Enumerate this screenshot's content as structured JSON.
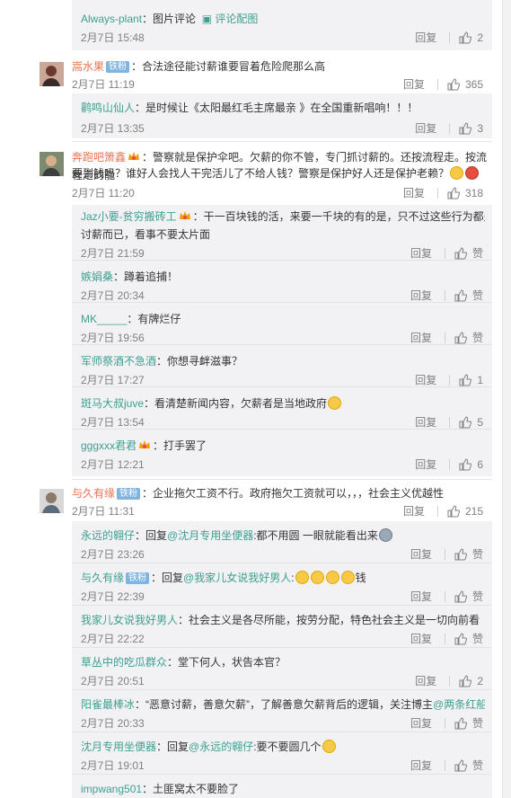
{
  "comments": [
    {
      "id": "c0-tail",
      "sub": [
        {
          "user": "Always-plant",
          "text": "：图片评论",
          "extra": "评论配图",
          "time": "2月7日 15:48",
          "reply": "回复",
          "likes": "2"
        }
      ]
    },
    {
      "id": "c1",
      "user": "嵩水果",
      "badge": "铁粉",
      "text": "：合法途径能讨薪谁要冒着危险爬那么高",
      "time": "2月7日 11:19",
      "reply": "回复",
      "likes": "365",
      "sub": [
        {
          "user": "鹳鸣山仙人",
          "text": "：是时候让《太阳最红毛主席最亲 》在全国重新唱响！！！",
          "time": "2月7日 13:35",
          "reply": "回复",
          "likes": "3"
        }
      ]
    },
    {
      "id": "c2",
      "user": "奔跑吧箫鑫",
      "text1": "：警察就是保护伞吧。欠薪的你不管，专门抓讨薪的。还按流程走。按流程走的能",
      "text2": "要到钱吗？谁好人会找人干完活儿了不给人钱？警察是保护好人还是保护老赖？",
      "time": "2月7日 11:20",
      "reply": "回复",
      "likes": "318",
      "sub": [
        {
          "user": "Jaz小要-贫穷搬砖工",
          "text1": "：干一百块钱的活，来要一千块的有的是，只不过这些行为都是恶意",
          "text2": "讨薪而已，看事不要太片面",
          "time": "2月7日 21:59",
          "reply": "回复",
          "likes": "赞"
        },
        {
          "user": "嫉娟桑",
          "text": "：蹲着追捕！",
          "time": "2月7日 20:34",
          "reply": "回复",
          "likes": "赞"
        },
        {
          "user": "MK_____",
          "text": "：有牌烂仔",
          "time": "2月7日 19:56",
          "reply": "回复",
          "likes": "赞"
        },
        {
          "user": "军师祭酒不急酒",
          "text": "：你想寻衅滋事？",
          "time": "2月7日 17:27",
          "reply": "回复",
          "likes": "1"
        },
        {
          "user": "斑马大叔juve",
          "text": "：看清楚新闻内容，欠薪者是当地政府",
          "time": "2月7日 13:54",
          "reply": "回复",
          "likes": "5"
        },
        {
          "user": "gggxxx君君",
          "text": "：打手罢了",
          "time": "2月7日 12:21",
          "reply": "回复",
          "likes": "6"
        }
      ]
    },
    {
      "id": "c3",
      "user": "与久有缘",
      "badge": "铁粉",
      "text": "：企业拖欠工资不行。政府拖欠工资就可以，，，社会主义优越性",
      "time": "2月7日 11:31",
      "reply": "回复",
      "likes": "215",
      "sub": [
        {
          "user": "永远的翱仔",
          "text": "：回复",
          "mention": "@沈月专用坐便器",
          "text2": ":都不用圆 一眼就能看出来",
          "time": "2月7日 23:26",
          "reply": "回复",
          "likes": "赞"
        },
        {
          "user": "与久有缘",
          "badge": "铁粉",
          "text": "：回复",
          "mention": "@我家儿女说我好男人",
          "text2": ":",
          "text3": "钱",
          "time": "2月7日 22:39",
          "reply": "回复",
          "likes": "赞"
        },
        {
          "user": "我家儿女说我好男人",
          "text": "：社会主义是各尽所能，按劳分配，特色社会主义是一切向前看",
          "time": "2月7日 22:22",
          "reply": "回复",
          "likes": "赞"
        },
        {
          "user": "草丛中的吃瓜群众",
          "text": "：堂下何人，状告本官？",
          "time": "2月7日 20:51",
          "reply": "回复",
          "likes": "2"
        },
        {
          "user": "阳雀最棒冰",
          "text": "：“恶意讨薪，善意欠薪”，了解善意欠薪背后的逻辑，关注博主",
          "mention": "@两条红船",
          "time": "2月7日 20:33",
          "reply": "回复",
          "likes": "赞"
        },
        {
          "user": "沈月专用坐便器",
          "text": "：回复",
          "mention": "@永远的翱仔",
          "text2": ":要不要圆几个",
          "time": "2月7日 19:01",
          "reply": "回复",
          "likes": "赞"
        },
        {
          "user": "impwang501",
          "text": "：土匪窝太不要脸了"
        }
      ]
    }
  ],
  "colors": {
    "name": "#eb7350",
    "subname": "#3d9f8f",
    "time": "#808080",
    "subbg": "#f2f2f5"
  }
}
